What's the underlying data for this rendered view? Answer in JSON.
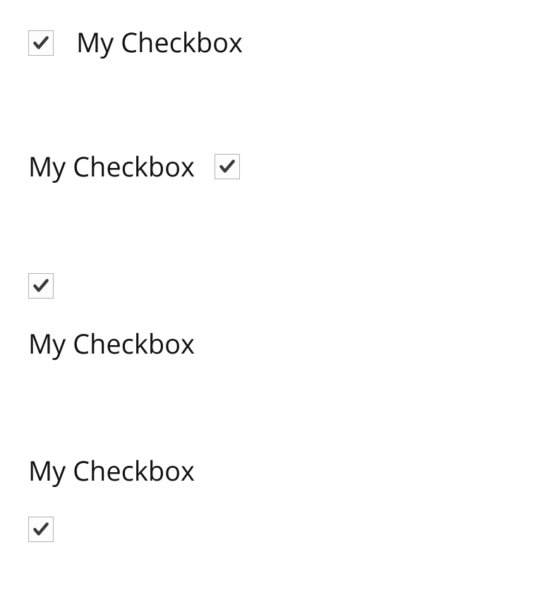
{
  "checkboxes": [
    {
      "label": "My Checkbox",
      "checked": true,
      "layout": "box-left"
    },
    {
      "label": "My Checkbox",
      "checked": true,
      "layout": "box-right"
    },
    {
      "label": "My Checkbox",
      "checked": true,
      "layout": "box-top"
    },
    {
      "label": "My Checkbox",
      "checked": true,
      "layout": "box-bottom"
    }
  ]
}
